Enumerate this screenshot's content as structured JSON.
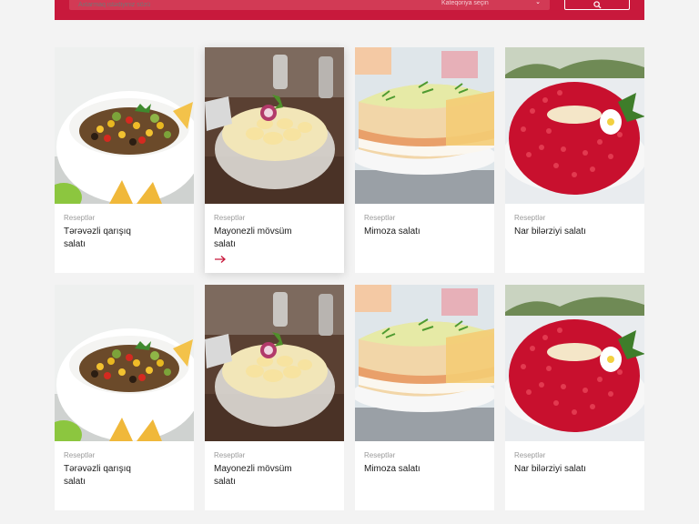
{
  "search": {
    "placeholder": "Axtarmaq istədiyiniz sözü",
    "category_placeholder": "Kateqoriya seçin",
    "icons": {
      "search": "search-icon",
      "dropdown": "chevron-down-icon"
    }
  },
  "colors": {
    "brand": "#c8193c",
    "accent": "#c8193c"
  },
  "cards": [
    {
      "category": "Reseptlər",
      "title": "Tərəvəzli qarışıq salatı",
      "image": "corn-bean-salad"
    },
    {
      "category": "Reseptlər",
      "title": "Mayonezli mövsüm salatı",
      "image": "potato-salad"
    },
    {
      "category": "Reseptlər",
      "title": "Mimoza salatı",
      "image": "mimosa-salad"
    },
    {
      "category": "Reseptlər",
      "title": "Nar bilərziyi salatı",
      "image": "pomegranate-salad"
    },
    {
      "category": "Reseptlər",
      "title": "Tərəvəzli qarışıq salatı",
      "image": "corn-bean-salad"
    },
    {
      "category": "Reseptlər",
      "title": "Mayonezli mövsüm salatı",
      "image": "potato-salad"
    },
    {
      "category": "Reseptlər",
      "title": "Mimoza salatı",
      "image": "mimosa-salad"
    },
    {
      "category": "Reseptlər",
      "title": "Nar bilərziyi salatı",
      "image": "pomegranate-salad"
    }
  ]
}
